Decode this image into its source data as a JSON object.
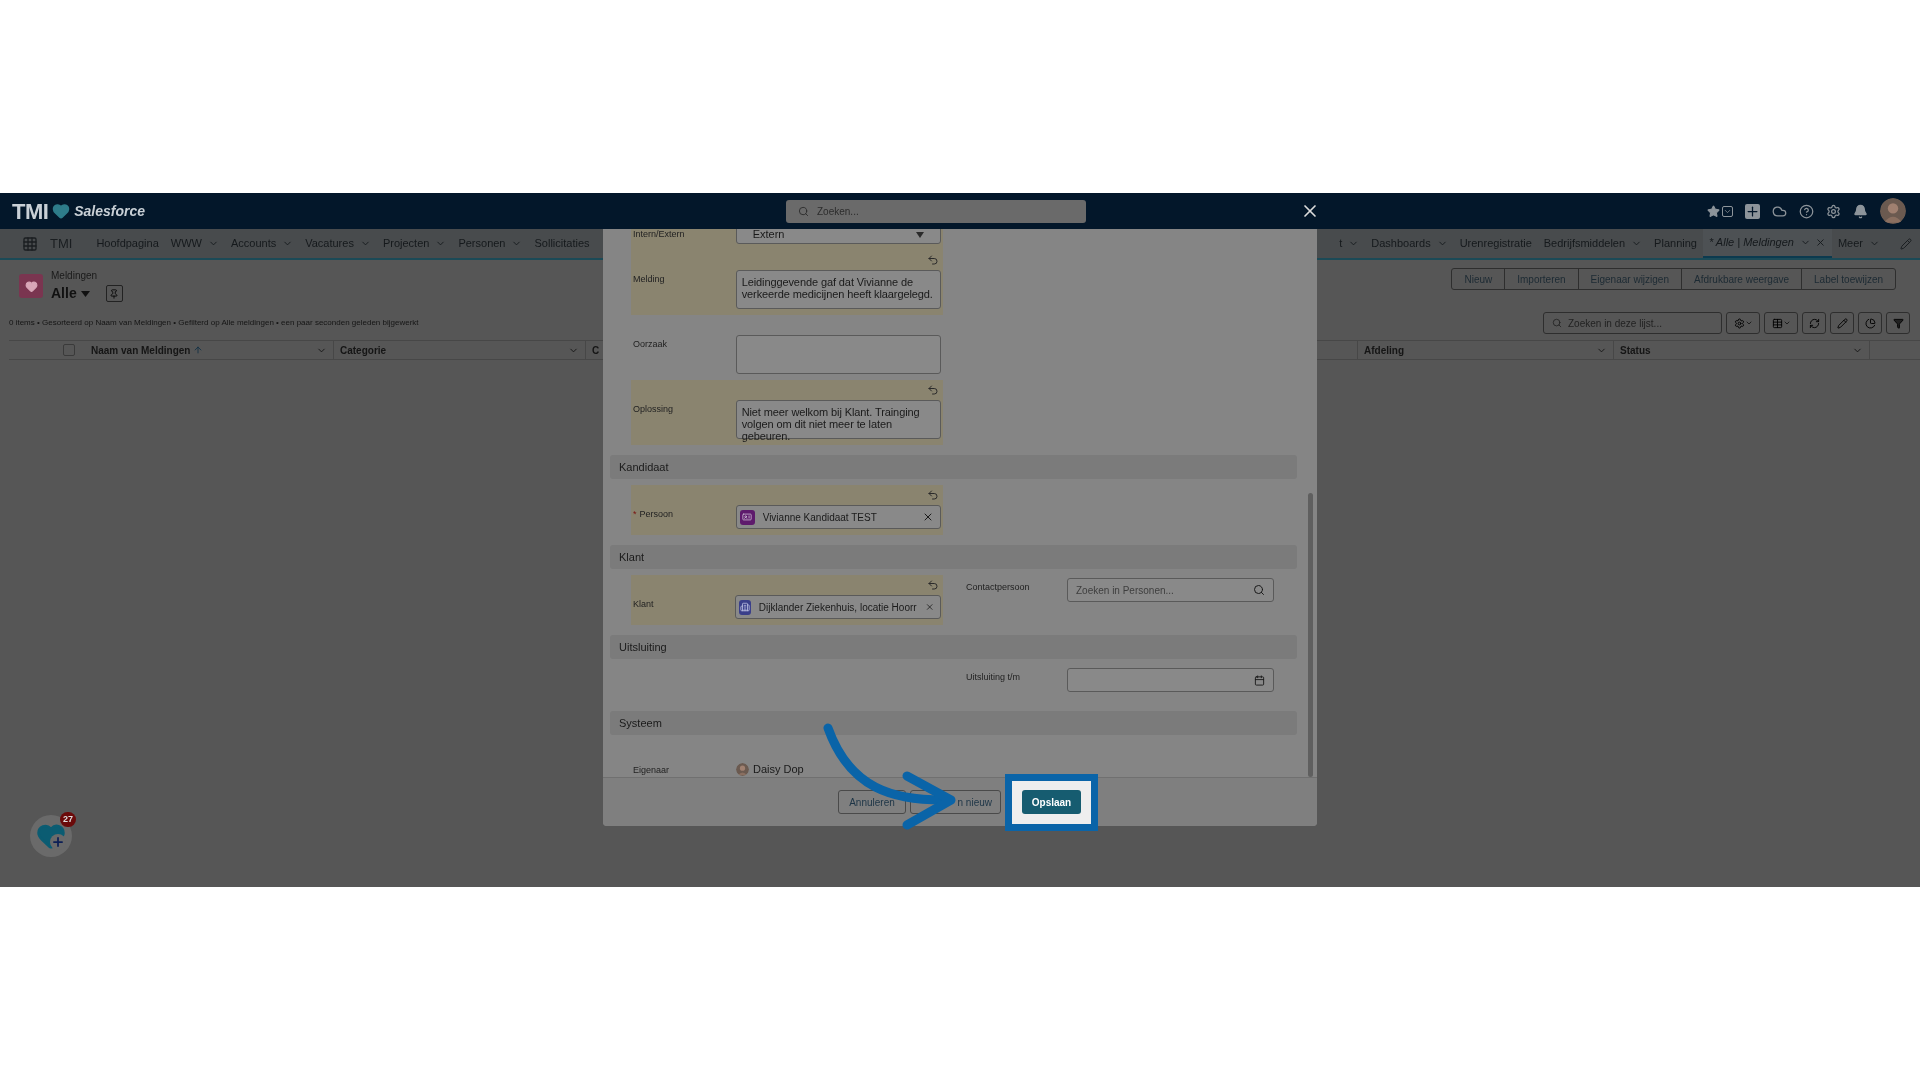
{
  "header": {
    "logo": "TMI",
    "brand": "Salesforce",
    "search_placeholder": "Zoeken..."
  },
  "nav": {
    "app_name": "TMI",
    "left_items": [
      {
        "label": "Hoofdpagina",
        "dropdown": false,
        "selected": false
      },
      {
        "label": "WWW",
        "dropdown": true,
        "selected": false
      },
      {
        "label": "Accounts",
        "dropdown": true,
        "selected": false
      },
      {
        "label": "Vacatures",
        "dropdown": true,
        "selected": false
      },
      {
        "label": "Projecten",
        "dropdown": true,
        "selected": false
      },
      {
        "label": "Personen",
        "dropdown": true,
        "selected": false
      },
      {
        "label": "Sollicitaties",
        "dropdown": false,
        "selected": false
      }
    ],
    "right_items": [
      {
        "label": "t",
        "dropdown": true,
        "selected": false
      },
      {
        "label": "Dashboards",
        "dropdown": true,
        "selected": false
      },
      {
        "label": "Urenregistratie",
        "dropdown": false,
        "selected": false
      },
      {
        "label": "Bedrijfsmiddelen",
        "dropdown": true,
        "selected": false
      },
      {
        "label": "Planning",
        "dropdown": false,
        "selected": false
      },
      {
        "label": "* Alle | Meldingen",
        "dropdown": true,
        "selected": true
      },
      {
        "label": "Meer",
        "dropdown": true,
        "selected": false
      }
    ]
  },
  "list": {
    "object": "Meldingen",
    "view": "Alle",
    "status": "0 items • Gesorteerd op Naam van Meldingen • Gefilterd op Alle meldingen • een paar seconden geleden bijgewerkt",
    "actions": [
      "Nieuw",
      "Importeren",
      "Eigenaar wijzigen",
      "Afdrukbare weergave",
      "Label toewijzen"
    ],
    "search_placeholder": "Zoeken in deze lijst...",
    "select_all_checked": false,
    "columns": [
      {
        "label": "Naam van Meldingen",
        "sorted": true
      },
      {
        "label": "Categorie",
        "sorted": false
      },
      {
        "label": "C",
        "sorted": false
      },
      {
        "label": "Afdeling",
        "sorted": false
      },
      {
        "label": "Status",
        "sorted": false
      }
    ]
  },
  "modal": {
    "rows": [
      {
        "label": "Intern/Extern",
        "kind": "select",
        "value": "Extern",
        "changed": true
      },
      {
        "label": "Melding",
        "kind": "textarea",
        "value": "Leidinggevende gaf dat Vivianne de verkeerde medicijnen heeft klaargelegd.",
        "changed": true
      },
      {
        "label": "Oorzaak",
        "kind": "textarea",
        "changed": false
      },
      {
        "label": "Oplossing",
        "kind": "textarea",
        "value": "Niet meer welkom bij Klant. Trainging volgen om dit niet meer te laten gebeuren.",
        "changed": true
      }
    ],
    "sections": [
      {
        "title": "Kandidaat",
        "rows": [
          {
            "left": {
              "label": "Persoon",
              "required_mark": "*",
              "kind": "lookup",
              "value": "Vivianne Kandidaat TEST",
              "color": "#5e1a6c",
              "changed": true
            }
          }
        ]
      },
      {
        "title": "Klant",
        "rows": [
          {
            "left": {
              "label": "Klant",
              "kind": "lookup",
              "value": "Dijklander Ziekenhuis, locatie Hoorr",
              "color": "#3a3f8a",
              "changed": true
            },
            "right": {
              "label": "Contactpersoon",
              "kind": "search",
              "placeholder": "Zoeken in Personen..."
            }
          }
        ]
      },
      {
        "title": "Uitsluiting",
        "rows": [
          {
            "right": {
              "label": "Uitsluiting t/m",
              "kind": "date"
            }
          }
        ]
      },
      {
        "title": "Systeem",
        "rows": [
          {
            "left": {
              "label": "Eigenaar",
              "kind": "user",
              "value": "Daisy Dop",
              "changed": false
            }
          }
        ]
      }
    ],
    "buttons": [
      {
        "label": "Annuleren",
        "highlighted": false
      },
      {
        "label": "n nieuw",
        "highlighted": false
      },
      {
        "label": "Opslaan",
        "highlighted": true
      }
    ]
  },
  "badge": {
    "count": "27"
  }
}
